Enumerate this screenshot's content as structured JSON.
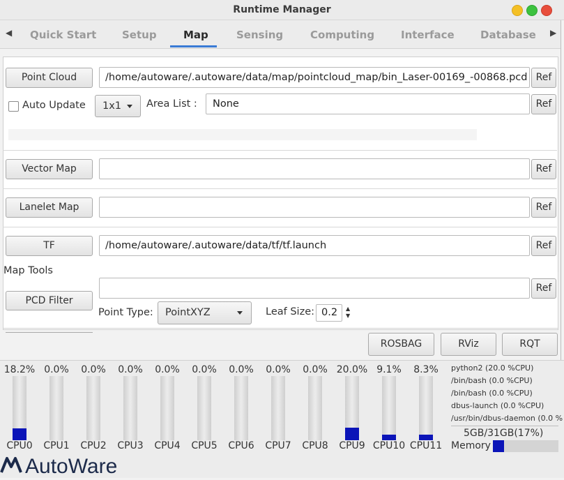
{
  "window": {
    "title": "Runtime Manager"
  },
  "tabs": [
    {
      "label": "Quick Start"
    },
    {
      "label": "Setup"
    },
    {
      "label": "Map"
    },
    {
      "label": "Sensing"
    },
    {
      "label": "Computing"
    },
    {
      "label": "Interface"
    },
    {
      "label": "Database"
    }
  ],
  "active_tab": "Map",
  "map": {
    "point_cloud": {
      "button": "Point Cloud",
      "path": "/home/autoware/.autoware/data/map/pointcloud_map/bin_Laser-00169_-00868.pcd",
      "ref": "Ref",
      "auto_update_label": "Auto Update",
      "auto_update_checked": false,
      "grid_value": "1x1",
      "area_list_label": "Area List :",
      "area_list_value": "None",
      "area_ref": "Ref"
    },
    "vector_map": {
      "button": "Vector Map",
      "path": "",
      "ref": "Ref"
    },
    "lanelet_map": {
      "button": "Lanelet Map",
      "path": "",
      "ref": "Ref"
    },
    "tf": {
      "button": "TF",
      "path": "/home/autoware/.autoware/data/tf/tf.launch",
      "ref": "Ref"
    },
    "map_tools": {
      "section_label": "Map Tools",
      "pcd_filter_button": "PCD Filter",
      "path": "",
      "ref": "Ref",
      "point_type_label": "Point Type:",
      "point_type_value": "PointXYZ",
      "leaf_size_label": "Leaf Size:",
      "leaf_size_value": "0.2"
    }
  },
  "bottom_buttons": {
    "rosbag": "ROSBAG",
    "rviz": "RViz",
    "rqt": "RQT"
  },
  "cpus": [
    {
      "name": "CPU0",
      "pct_text": "18.2%",
      "load": 0.182
    },
    {
      "name": "CPU1",
      "pct_text": "0.0%",
      "load": 0.0
    },
    {
      "name": "CPU2",
      "pct_text": "0.0%",
      "load": 0.0
    },
    {
      "name": "CPU3",
      "pct_text": "0.0%",
      "load": 0.0
    },
    {
      "name": "CPU4",
      "pct_text": "0.0%",
      "load": 0.0
    },
    {
      "name": "CPU5",
      "pct_text": "0.0%",
      "load": 0.0
    },
    {
      "name": "CPU6",
      "pct_text": "0.0%",
      "load": 0.0
    },
    {
      "name": "CPU7",
      "pct_text": "0.0%",
      "load": 0.0
    },
    {
      "name": "CPU8",
      "pct_text": "0.0%",
      "load": 0.0
    },
    {
      "name": "CPU9",
      "pct_text": "20.0%",
      "load": 0.2
    },
    {
      "name": "CPU10",
      "pct_text": "9.1%",
      "load": 0.091
    },
    {
      "name": "CPU11",
      "pct_text": "8.3%",
      "load": 0.083
    }
  ],
  "processes": [
    "python2 (20.0 %CPU)",
    "/bin/bash (0.0 %CPU)",
    "/bin/bash (0.0 %CPU)",
    "dbus-launch (0.0 %CPU)",
    "/usr/bin/dbus-daemon (0.0 %"
  ],
  "memory": {
    "label": "Memory",
    "text": "5GB/31GB(17%)",
    "fraction": 0.17
  },
  "logo_text": "AutoWare",
  "colors": {
    "accent": "#3a7bd5",
    "cpu_fill": "#0b14b8"
  }
}
